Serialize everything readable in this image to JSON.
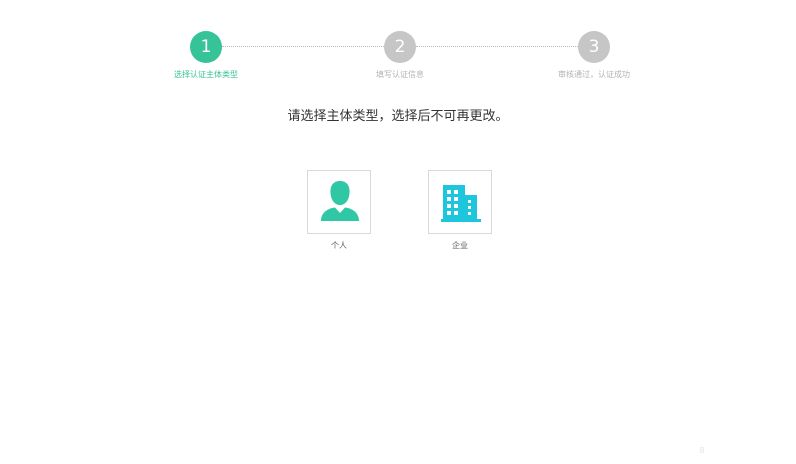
{
  "colors": {
    "active": "#36c398",
    "inactive": "#c6c6c6",
    "person_icon": "#2fc7a4",
    "company_icon": "#1ec6dd"
  },
  "steps": [
    {
      "number": "1",
      "label": "选择认证主体类型",
      "state": "active"
    },
    {
      "number": "2",
      "label": "填写认证信息",
      "state": "inactive"
    },
    {
      "number": "3",
      "label": "审核通过，认证成功",
      "state": "inactive"
    }
  ],
  "instruction": "请选择主体类型，选择后不可再更改。",
  "options": [
    {
      "label": "个人",
      "icon": "person-icon"
    },
    {
      "label": "企业",
      "icon": "building-icon"
    }
  ],
  "page_number": "8"
}
